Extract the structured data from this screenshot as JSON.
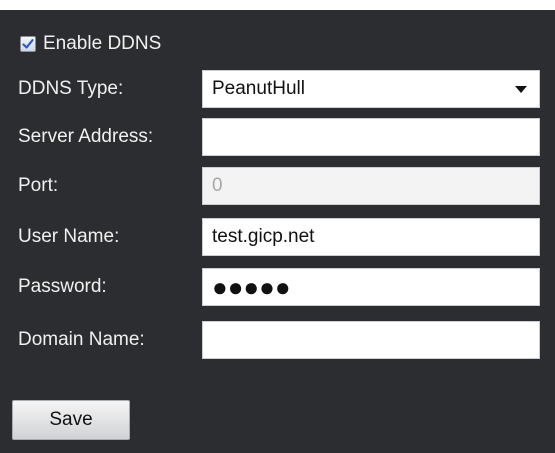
{
  "enable_ddns": {
    "label": "Enable DDNS",
    "checked": true
  },
  "fields": {
    "ddns_type": {
      "label": "DDNS Type:",
      "value": "PeanutHull"
    },
    "server_address": {
      "label": "Server Address:",
      "value": ""
    },
    "port": {
      "label": "Port:",
      "value": "0"
    },
    "user_name": {
      "label": "User Name:",
      "value": "test.gicp.net"
    },
    "password": {
      "label": "Password:",
      "value": "●●●●●"
    },
    "domain_name": {
      "label": "Domain Name:",
      "value": ""
    }
  },
  "save": {
    "label": "Save"
  },
  "colors": {
    "panel_background": "#2b2d30",
    "label_text": "#f0f0f0",
    "input_background": "#ffffff",
    "disabled_input_background": "#f3f3f3",
    "checkbox_check": "#2b5cc7"
  },
  "icons": {
    "checkbox": "checkmark-icon",
    "select_arrow": "chevron-down-icon"
  }
}
